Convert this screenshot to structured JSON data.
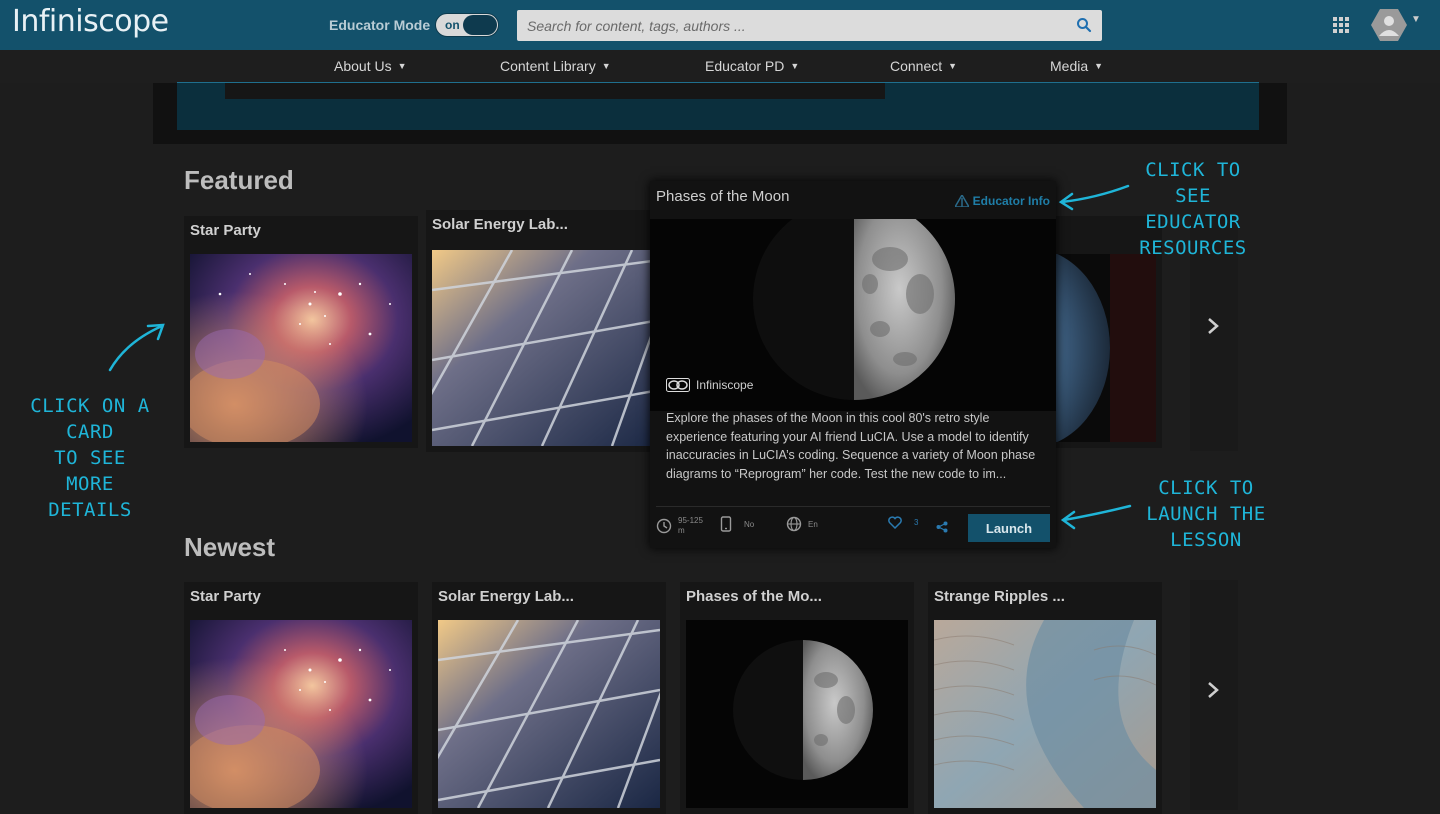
{
  "header": {
    "logo": "Infiniscope",
    "educator_mode_label": "Educator Mode",
    "toggle_label": "on",
    "search_placeholder": "Search for content, tags, authors ..."
  },
  "nav": {
    "items": [
      {
        "label": "About Us"
      },
      {
        "label": "Content Library"
      },
      {
        "label": "Educator PD"
      },
      {
        "label": "Connect"
      },
      {
        "label": "Media"
      }
    ]
  },
  "featured": {
    "title": "Featured",
    "cards": [
      {
        "title": "Star Party"
      },
      {
        "title": "Solar Energy Lab..."
      }
    ]
  },
  "popup": {
    "title": "Phases of the Moon",
    "educator_info": "Educator Info",
    "provider": "Infiniscope",
    "description": "Explore the phases of the Moon in this cool 80's retro style experience featuring your AI friend LuCIA. Use a model to identify inaccuracies in LuCIA’s coding. Sequence a variety of Moon phase diagrams to “Reprogram” her code. Test the new code to im...",
    "duration_line1": "95-125",
    "duration_line2": "m",
    "mobile": "No",
    "language": "En",
    "likes": "3",
    "launch_label": "Launch"
  },
  "newest": {
    "title": "Newest",
    "cards": [
      {
        "title": "Star Party"
      },
      {
        "title": "Solar Energy Lab..."
      },
      {
        "title": "Phases of the Mo..."
      },
      {
        "title": "Strange Ripples ..."
      }
    ]
  },
  "annotations": {
    "card": [
      "CLICK ON A",
      "CARD",
      "TO SEE",
      "MORE",
      "DETAILS"
    ],
    "educator": [
      "CLICK TO",
      "SEE",
      "EDUCATOR",
      "RESOURCES"
    ],
    "launch": [
      "CLICK TO",
      "LAUNCH THE",
      "LESSON"
    ]
  },
  "colors": {
    "header_bg": "#13516b",
    "accent": "#1f7ea8",
    "annotation": "#1fb5d8"
  }
}
